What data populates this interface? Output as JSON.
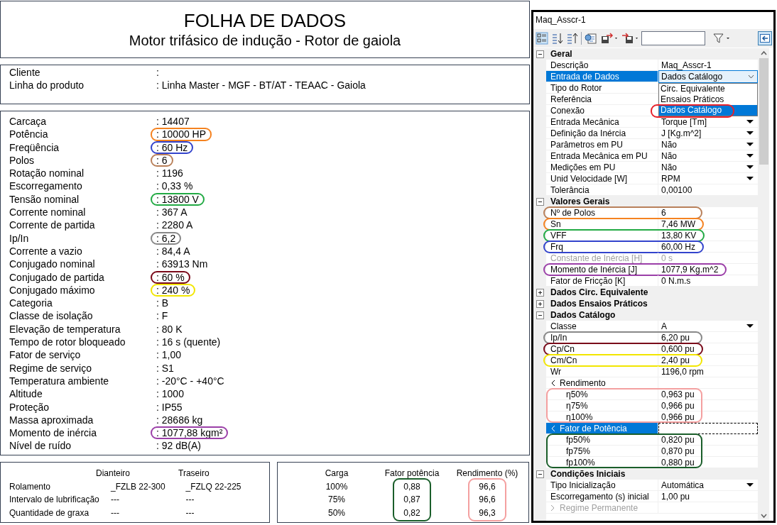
{
  "datasheet": {
    "title": "FOLHA DE DADOS",
    "subtitle": "Motor trifásico de indução - Rotor de gaiola",
    "client": [
      {
        "label": "Cliente",
        "value": ":"
      },
      {
        "label": "Linha do produto",
        "value": ": Linha Master - MGF - BT/AT - TEAAC - Gaiola"
      }
    ],
    "specs": [
      {
        "label": "Carcaça",
        "value": ": 14407"
      },
      {
        "label": "Potência",
        "value": ": 10000 HP",
        "color": "#f58220"
      },
      {
        "label": "Freqüência",
        "value": ": 60 Hz",
        "color": "#3344cc"
      },
      {
        "label": "Polos",
        "value": ": 6",
        "color": "#b9805a"
      },
      {
        "label": "Rotação nominal",
        "value": ": 1196"
      },
      {
        "label": "Escorregamento",
        "value": ": 0,33 %"
      },
      {
        "label": "Tensão nominal",
        "value": ": 13800 V",
        "color": "#22aa44"
      },
      {
        "label": "Corrente nominal",
        "value": ": 367 A"
      },
      {
        "label": "Corrente de partida",
        "value": ": 2280 A"
      },
      {
        "label": "Ip/In",
        "value": ": 6,2",
        "color": "#888888"
      },
      {
        "label": "Corrente a vazio",
        "value": ": 84,4 A"
      },
      {
        "label": "Conjugado nominal",
        "value": ": 63913 Nm"
      },
      {
        "label": "Conjugado de partida",
        "value": ": 60 %",
        "color": "#7a0a1a"
      },
      {
        "label": "Conjugado máximo",
        "value": ": 240 %",
        "color": "#f2e600"
      },
      {
        "label": "Categoria",
        "value": ": B"
      },
      {
        "label": "Classe de isolação",
        "value": ": F"
      },
      {
        "label": "Elevação de temperatura",
        "value": ": 80 K"
      },
      {
        "label": "Tempo de rotor bloqueado",
        "value": ": 16 s (quente)"
      },
      {
        "label": "Fator de serviço",
        "value": ": 1,00"
      },
      {
        "label": "Regime de serviço",
        "value": ": S1"
      },
      {
        "label": "Temperatura ambiente",
        "value": ": -20°C  -  +40°C"
      },
      {
        "label": "Altitude",
        "value": ": 1000"
      },
      {
        "label": "Proteção",
        "value": ": IP55"
      },
      {
        "label": "Massa aproximada",
        "value": ": 28686 kg"
      },
      {
        "label": "Momento de inércia",
        "value": ": 1077,88 kgm²",
        "color": "#9b3fa8"
      },
      {
        "label": "Nível de ruído",
        "value": ": 92 dB(A)"
      }
    ],
    "bearings": {
      "columns": [
        "Dianteiro",
        "Traseiro"
      ],
      "rows": [
        {
          "label": "Rolamento",
          "values": [
            "_FZLB 22-300",
            "_FZLQ 22-225"
          ]
        },
        {
          "label": "Intervalo de lubrificação",
          "values": [
            "---",
            "---"
          ]
        },
        {
          "label": "Quantidade de graxa",
          "values": [
            "---",
            "---"
          ]
        }
      ]
    },
    "performance": {
      "columns": [
        {
          "heading": "Carga",
          "values": [
            "100%",
            "75%",
            "50%"
          ]
        },
        {
          "heading": "Fator potência",
          "values": [
            "0,88",
            "0,87",
            "0,82"
          ],
          "color": "#1a5e2a"
        },
        {
          "heading": "Rendimento (%)",
          "values": [
            "96,6",
            "96,6",
            "96,3"
          ],
          "color": "#f4a0a0"
        }
      ]
    }
  },
  "properties": {
    "title": "Maq_Asscr-1",
    "groups": [
      {
        "name": "Geral",
        "expanded": true,
        "rows": [
          {
            "kind": "text",
            "name": "Descrição",
            "value": "Maq_Asscr-1",
            "selected": false,
            "disabled": false
          },
          {
            "kind": "dropdown",
            "name": "Entrada de Dados",
            "value": "Dados Catálogo",
            "selected": true,
            "disabled": false,
            "open": true
          },
          {
            "kind": "text",
            "name": "Tipo do Rotor",
            "selected": false,
            "disabled": false
          },
          {
            "kind": "text",
            "name": "Referência",
            "selected": false,
            "disabled": false
          },
          {
            "kind": "text",
            "name": "Conexão",
            "selected": false,
            "disabled": false
          },
          {
            "kind": "dropdown",
            "name": "Entrada Mecânica",
            "value": "Torque [Tm]",
            "selected": false,
            "disabled": false
          },
          {
            "kind": "dropdown",
            "name": "Definição da Inércia",
            "value": "J [Kg.m^2]",
            "selected": false,
            "disabled": false
          },
          {
            "kind": "dropdown",
            "name": "Parâmetros em PU",
            "value": "Não",
            "selected": false,
            "disabled": false
          },
          {
            "kind": "dropdown",
            "name": "Entrada Mecânica em PU",
            "value": "Não",
            "selected": false,
            "disabled": false
          },
          {
            "kind": "dropdown",
            "name": "Medições em PU",
            "value": "Não",
            "selected": false,
            "disabled": false
          },
          {
            "kind": "dropdown",
            "name": "Unid Velocidade [W]",
            "value": "RPM",
            "selected": false,
            "disabled": false
          },
          {
            "kind": "text",
            "name": "Tolerância",
            "value": "0,00100",
            "selected": false,
            "disabled": false
          }
        ]
      },
      {
        "name": "Valores Gerais",
        "expanded": true,
        "rows": [
          {
            "kind": "text",
            "name": "Nº de Polos",
            "value": "6",
            "selected": false,
            "disabled": false,
            "color": "#b9805a"
          },
          {
            "kind": "text",
            "name": "Sn",
            "value": "7,46 MW",
            "selected": false,
            "disabled": false,
            "color": "#f58220"
          },
          {
            "kind": "text",
            "name": "VFF",
            "value": "13,80 KV",
            "selected": false,
            "disabled": false,
            "color": "#22aa44"
          },
          {
            "kind": "text",
            "name": "Frq",
            "value": "60,00 Hz",
            "selected": false,
            "disabled": false,
            "color": "#3344cc"
          },
          {
            "kind": "text",
            "name": "Constante de Inércia [H]",
            "value": "0 s",
            "selected": false,
            "disabled": true
          },
          {
            "kind": "text",
            "name": "Momento de Inércia [J]",
            "value": "1077,9 Kg.m^2",
            "selected": false,
            "disabled": false,
            "color": "#9b3fa8"
          },
          {
            "kind": "text",
            "name": "Fator de Fricção [K]",
            "value": "0 N.m.s",
            "selected": false,
            "disabled": false
          }
        ]
      },
      {
        "name": "Dados Circ. Equivalente",
        "expanded": false
      },
      {
        "name": "Dados Ensaios Práticos",
        "expanded": false
      },
      {
        "name": "Dados Catálogo",
        "expanded": true,
        "rows": [
          {
            "kind": "dropdown",
            "name": "Classe",
            "value": "A",
            "selected": false,
            "disabled": false
          },
          {
            "kind": "text",
            "name": "Ip/In",
            "value": "6,20 pu",
            "selected": false,
            "disabled": false,
            "color": "#888888"
          },
          {
            "kind": "text",
            "name": "Cp/Cn",
            "value": "0,600 pu",
            "selected": false,
            "disabled": false,
            "color": "#7a0a1a"
          },
          {
            "kind": "text",
            "name": "Cm/Cn",
            "value": "2,40 pu",
            "selected": false,
            "disabled": false,
            "color": "#f2e600"
          },
          {
            "kind": "text",
            "name": "Wr",
            "value": "1196,0 rpm",
            "selected": false,
            "disabled": false
          },
          {
            "kind": "subgroup",
            "name": "Rendimento",
            "expanded": true,
            "selected": false,
            "disabled": false,
            "color": "#f4a0a0",
            "children": [
              {
                "kind": "text",
                "name": "η50%",
                "value": "0,963 pu",
                "selected": false,
                "disabled": false
              },
              {
                "kind": "text",
                "name": "η75%",
                "value": "0,966 pu",
                "selected": false,
                "disabled": false
              },
              {
                "kind": "text",
                "name": "η100%",
                "value": "0,966 pu",
                "selected": false,
                "disabled": false
              }
            ]
          },
          {
            "kind": "subgroup",
            "name": "Fator de Potência",
            "expanded": true,
            "selected": true,
            "disabled": false,
            "color": "#1a5e2a",
            "children": [
              {
                "kind": "text",
                "name": "fp50%",
                "value": "0,820 pu",
                "selected": false,
                "disabled": false
              },
              {
                "kind": "text",
                "name": "fp75%",
                "value": "0,870 pu",
                "selected": false,
                "disabled": false
              },
              {
                "kind": "text",
                "name": "fp100%",
                "value": "0,880 pu",
                "selected": false,
                "disabled": false
              }
            ]
          }
        ]
      },
      {
        "name": "Condições Iniciais",
        "expanded": true,
        "rows": [
          {
            "kind": "dropdown",
            "name": "Tipo Inicialização",
            "value": "Automática",
            "selected": false,
            "disabled": false
          },
          {
            "kind": "text",
            "name": "Escorregamento (s) inicial",
            "value": "1,00 pu",
            "selected": false,
            "disabled": false
          },
          {
            "kind": "subgroup",
            "name": "Regime Permanente",
            "expanded": false,
            "selected": false,
            "disabled": true
          }
        ]
      }
    ],
    "dropdown_options": [
      {
        "label": "Circ. Equivalente",
        "selected": false
      },
      {
        "label": "Ensaios Práticos",
        "selected": false
      },
      {
        "label": "Dados Catálogo",
        "selected": true,
        "color": "#e8202a"
      }
    ]
  }
}
